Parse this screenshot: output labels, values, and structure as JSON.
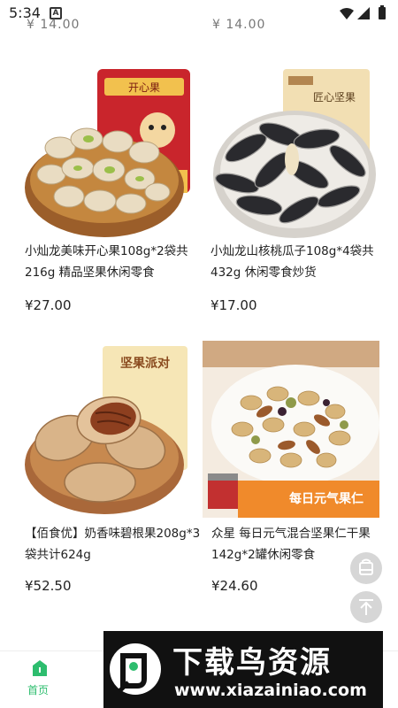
{
  "status_bar": {
    "time": "5:34",
    "notification_icon": "A"
  },
  "top_partial": {
    "left": "¥ 14.00",
    "right": "¥ 14.00"
  },
  "products": [
    {
      "title": "小灿龙美味开心果108g*2袋共216g 精品坚果休闲零食",
      "price": "¥27.00",
      "package_text": "开心果"
    },
    {
      "title": "小灿龙山核桃瓜子108g*4袋共432g 休闲零食炒货",
      "price": "¥17.00",
      "package_text": "匠心坚果"
    },
    {
      "title": "【佰食优】奶香味碧根果208g*3袋共计624g",
      "price": "¥52.50",
      "package_text": "坚果派对"
    },
    {
      "title": "众星 每日元气混合坚果仁干果142g*2罐休闲零食",
      "price": "¥24.60",
      "banner_text": "每日元气果仁"
    }
  ],
  "float_buttons": {
    "cart": "cart-icon",
    "top": "back-to-top-icon"
  },
  "bottom_nav": {
    "home_label": "首页"
  },
  "watermark": {
    "title": "下载鸟资源",
    "url": "www.xiazainiao.com"
  },
  "colors": {
    "accent_green": "#2dbd6e",
    "text": "#222222",
    "float_button": "#d6d6d6"
  }
}
